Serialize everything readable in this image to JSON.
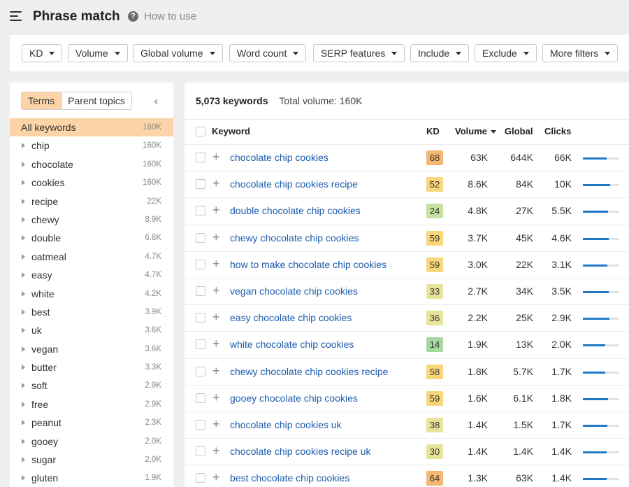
{
  "header": {
    "title": "Phrase match",
    "help_label": "How to use"
  },
  "filters": [
    {
      "label": "KD"
    },
    {
      "label": "Volume"
    },
    {
      "label": "Global volume"
    },
    {
      "label": "Word count"
    },
    {
      "label": "SERP features"
    },
    {
      "label": "Include"
    },
    {
      "label": "Exclude"
    },
    {
      "label": "More filters"
    }
  ],
  "sidebar": {
    "tabs": {
      "terms": "Terms",
      "parent_topics": "Parent topics"
    },
    "active_tab": "terms",
    "items": [
      {
        "label": "All keywords",
        "count": "160K",
        "selected": true
      },
      {
        "label": "chip",
        "count": "160K"
      },
      {
        "label": "chocolate",
        "count": "160K"
      },
      {
        "label": "cookies",
        "count": "160K"
      },
      {
        "label": "recipe",
        "count": "22K"
      },
      {
        "label": "chewy",
        "count": "8.9K"
      },
      {
        "label": "double",
        "count": "6.8K"
      },
      {
        "label": "oatmeal",
        "count": "4.7K"
      },
      {
        "label": "easy",
        "count": "4.7K"
      },
      {
        "label": "white",
        "count": "4.2K"
      },
      {
        "label": "best",
        "count": "3.9K"
      },
      {
        "label": "uk",
        "count": "3.6K"
      },
      {
        "label": "vegan",
        "count": "3.6K"
      },
      {
        "label": "butter",
        "count": "3.3K"
      },
      {
        "label": "soft",
        "count": "2.9K"
      },
      {
        "label": "free",
        "count": "2.9K"
      },
      {
        "label": "peanut",
        "count": "2.3K"
      },
      {
        "label": "gooey",
        "count": "2.0K"
      },
      {
        "label": "sugar",
        "count": "2.0K"
      },
      {
        "label": "gluten",
        "count": "1.9K"
      }
    ]
  },
  "results": {
    "keywords_count": "5,073 keywords",
    "total_volume": "Total volume: 160K",
    "columns": {
      "keyword": "Keyword",
      "kd": "KD",
      "volume": "Volume",
      "global": "Global",
      "clicks": "Clicks"
    },
    "rows": [
      {
        "keyword": "chocolate chip cookies",
        "kd": "68",
        "kd_color": "#f5b872",
        "volume": "63K",
        "global": "644K",
        "clicks": "66K",
        "click_share": 0.65
      },
      {
        "keyword": "chocolate chip cookies recipe",
        "kd": "52",
        "kd_color": "#fad67a",
        "volume": "8.6K",
        "global": "84K",
        "clicks": "10K",
        "click_share": 0.75
      },
      {
        "keyword": "double chocolate chip cookies",
        "kd": "24",
        "kd_color": "#c7e2a1",
        "volume": "4.8K",
        "global": "27K",
        "clicks": "5.5K",
        "click_share": 0.7
      },
      {
        "keyword": "chewy chocolate chip cookies",
        "kd": "59",
        "kd_color": "#fad67a",
        "volume": "3.7K",
        "global": "45K",
        "clicks": "4.6K",
        "click_share": 0.72
      },
      {
        "keyword": "how to make chocolate chip cookies",
        "kd": "59",
        "kd_color": "#fad67a",
        "volume": "3.0K",
        "global": "22K",
        "clicks": "3.1K",
        "click_share": 0.68
      },
      {
        "keyword": "vegan chocolate chip cookies",
        "kd": "33",
        "kd_color": "#e7e39a",
        "volume": "2.7K",
        "global": "34K",
        "clicks": "3.5K",
        "click_share": 0.72
      },
      {
        "keyword": "easy chocolate chip cookies",
        "kd": "36",
        "kd_color": "#e7e39a",
        "volume": "2.2K",
        "global": "25K",
        "clicks": "2.9K",
        "click_share": 0.74
      },
      {
        "keyword": "white chocolate chip cookies",
        "kd": "14",
        "kd_color": "#a6d7a0",
        "volume": "1.9K",
        "global": "13K",
        "clicks": "2.0K",
        "click_share": 0.62
      },
      {
        "keyword": "chewy chocolate chip cookies recipe",
        "kd": "58",
        "kd_color": "#fad67a",
        "volume": "1.8K",
        "global": "5.7K",
        "clicks": "1.7K",
        "click_share": 0.62
      },
      {
        "keyword": "gooey chocolate chip cookies",
        "kd": "59",
        "kd_color": "#fad67a",
        "volume": "1.6K",
        "global": "6.1K",
        "clicks": "1.8K",
        "click_share": 0.7
      },
      {
        "keyword": "chocolate chip cookies uk",
        "kd": "38",
        "kd_color": "#e7e39a",
        "volume": "1.4K",
        "global": "1.5K",
        "clicks": "1.7K",
        "click_share": 0.68
      },
      {
        "keyword": "chocolate chip cookies recipe uk",
        "kd": "30",
        "kd_color": "#e7e39a",
        "volume": "1.4K",
        "global": "1.4K",
        "clicks": "1.4K",
        "click_share": 0.66
      },
      {
        "keyword": "best chocolate chip cookies",
        "kd": "64",
        "kd_color": "#f5b872",
        "volume": "1.3K",
        "global": "63K",
        "clicks": "1.4K",
        "click_share": 0.66
      }
    ]
  }
}
